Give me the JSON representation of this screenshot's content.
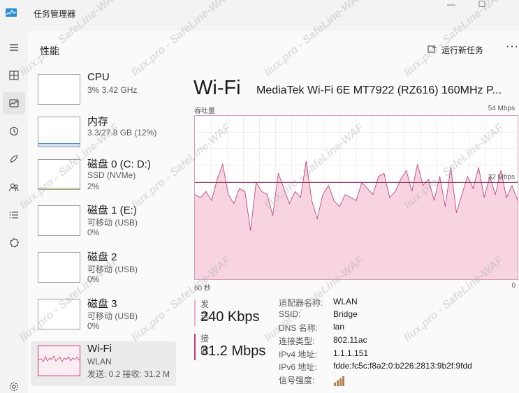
{
  "window": {
    "title": "任务管理器",
    "min": "—",
    "max": "☐"
  },
  "header": {
    "page_title": "性能",
    "run_task_label": "运行新任务",
    "more_label": "···"
  },
  "devices": [
    {
      "name": "CPU",
      "sub": "3%  3.42 GHz",
      "sub2": ""
    },
    {
      "name": "内存",
      "sub": "3.3/27.8 GB (12%)",
      "sub2": ""
    },
    {
      "name": "磁盘 0 (C: D:)",
      "sub": "SSD (NVMe)",
      "sub2": "2%"
    },
    {
      "name": "磁盘 1 (E:)",
      "sub": "可移动 (USB)",
      "sub2": "0%"
    },
    {
      "name": "磁盘 2",
      "sub": "可移动 (USB)",
      "sub2": "0%"
    },
    {
      "name": "磁盘 3",
      "sub": "可移动 (USB)",
      "sub2": "0%"
    },
    {
      "name": "Wi-Fi",
      "sub": "WLAN",
      "sub2": "发送: 0.2  接收: 31.2 M"
    }
  ],
  "main": {
    "title": "Wi-Fi",
    "adapter": "MediaTek Wi-Fi 6E MT7922 (RZ616) 160MHz P...",
    "axis_top_left": "吞吐量",
    "axis_top_right": "54 Mbps",
    "axis_bottom_left": "60 秒",
    "axis_bottom_right": "0",
    "ref_line_label": "32 Mbps"
  },
  "stats": {
    "send_label": "发送",
    "send_value": "240 Kbps",
    "recv_label": "接收",
    "recv_value": "31.2 Mbps"
  },
  "properties": [
    {
      "key": "适配器名称:",
      "value": "WLAN"
    },
    {
      "key": "SSID:",
      "value": "Bridge"
    },
    {
      "key": "DNS 名称:",
      "value": "lan"
    },
    {
      "key": "连接类型:",
      "value": "802.11ac"
    },
    {
      "key": "IPv4 地址:",
      "value": "1.1.1.151"
    },
    {
      "key": "IPv6 地址:",
      "value": "fdde:fc5c:f8a2:0:b226:2813:9b2f:9fdd"
    },
    {
      "key": "信号强度:",
      "value": ""
    }
  ],
  "watermark": "liux.pro - SafeLine-WAF",
  "chart_data": {
    "type": "area",
    "max": 54,
    "unit": "Mbps",
    "x_range_seconds": 60,
    "ref_line": 32,
    "values": [
      28,
      27,
      29,
      26,
      33,
      38,
      28,
      25,
      30,
      29,
      16,
      32,
      29,
      28,
      21,
      35,
      30,
      25,
      29,
      27,
      39,
      26,
      20,
      28,
      31,
      26,
      24,
      28,
      27,
      26,
      32,
      30,
      28,
      34,
      35,
      27,
      29,
      33,
      36,
      29,
      38,
      31,
      33,
      26,
      34,
      24,
      37,
      22,
      28,
      34,
      30,
      37,
      27,
      34,
      28,
      36,
      27,
      31,
      26
    ]
  },
  "colors": {
    "accent": "#c8397a",
    "fill": "#f8d3e0",
    "line": "#c04a7d",
    "refline": "#7e2a58"
  }
}
